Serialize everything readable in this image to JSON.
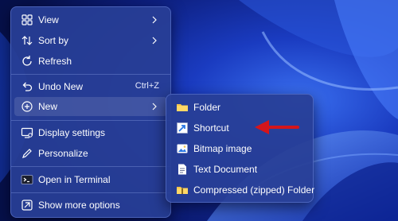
{
  "main_menu": {
    "items": [
      {
        "label": "View",
        "icon": "grid-icon"
      },
      {
        "label": "Sort by",
        "icon": "sort-icon"
      },
      {
        "label": "Refresh",
        "icon": "refresh-icon"
      },
      {
        "label": "Undo New",
        "shortcut": "Ctrl+Z",
        "icon": "undo-icon"
      },
      {
        "label": "New",
        "icon": "plus-circle-icon"
      },
      {
        "label": "Display settings",
        "icon": "display-icon"
      },
      {
        "label": "Personalize",
        "icon": "pen-icon"
      },
      {
        "label": "Open in Terminal",
        "icon": "terminal-icon"
      },
      {
        "label": "Show more options",
        "icon": "expand-icon"
      }
    ]
  },
  "sub_menu": {
    "items": [
      {
        "label": "Folder",
        "icon": "folder-icon"
      },
      {
        "label": "Shortcut",
        "icon": "shortcut-icon"
      },
      {
        "label": "Bitmap image",
        "icon": "image-icon"
      },
      {
        "label": "Text Document",
        "icon": "document-icon"
      },
      {
        "label": "Compressed (zipped) Folder",
        "icon": "zip-folder-icon"
      }
    ]
  },
  "colors": {
    "menu_bg": "#2a3e96",
    "arrow": "#d4151b",
    "folder": "#f4c34b",
    "accent": "#2b78e4"
  }
}
